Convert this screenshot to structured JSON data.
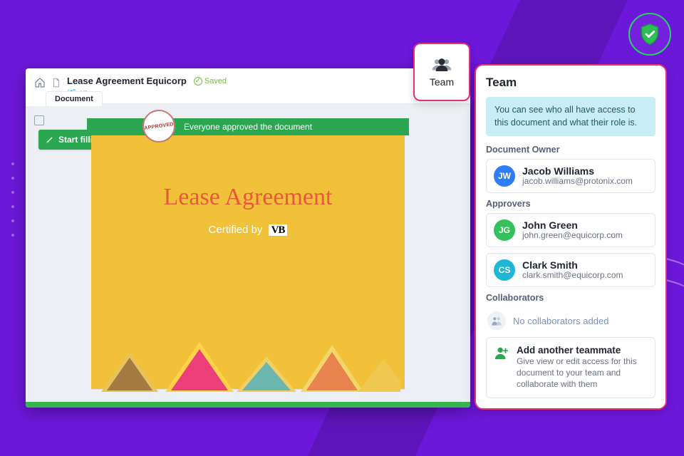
{
  "header": {
    "title": "Lease Agreement Equicorp",
    "saved_label": "Saved",
    "breadcrumb": "All"
  },
  "tabs": {
    "document": "Document"
  },
  "toolbar": {
    "start_filling": "Start filling"
  },
  "document": {
    "approval_banner": "Everyone approved the document",
    "stamp": "APPROVED",
    "page_title": "Lease Agreement",
    "certified_by_label": "Certified by",
    "certifier_logo_text": "VB"
  },
  "team_button": {
    "label": "Team"
  },
  "team_panel": {
    "title": "Team",
    "info": "You can see who all have access to this document and what their role is.",
    "sections": {
      "owner_label": "Document Owner",
      "approvers_label": "Approvers",
      "collaborators_label": "Collaborators"
    },
    "owner": {
      "initials": "JW",
      "name": "Jacob Williams",
      "email": "jacob.williams@protonix.com",
      "color": "#2d7ef7"
    },
    "approvers": [
      {
        "initials": "JG",
        "name": "John Green",
        "email": "john.green@equicorp.com",
        "color": "#34c05a"
      },
      {
        "initials": "CS",
        "name": "Clark Smith",
        "email": "clark.smith@equicorp.com",
        "color": "#1fb7d4"
      }
    ],
    "collaborators_empty": "No collaborators added",
    "add": {
      "title": "Add another teammate",
      "desc": "Give view or edit access for this document to your team and collaborate with them"
    }
  }
}
